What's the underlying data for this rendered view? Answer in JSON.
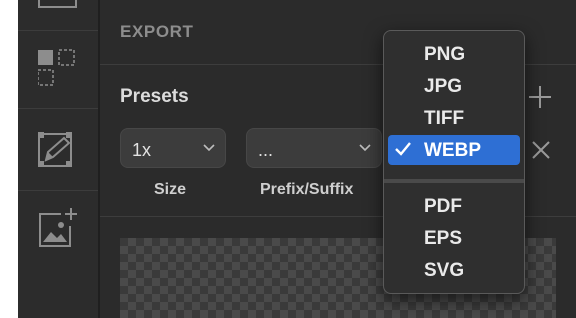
{
  "panel": {
    "section_title": "EXPORT",
    "presets_title": "Presets",
    "size_select": {
      "value": "1x",
      "label": "Size"
    },
    "prefix_select": {
      "value": "...",
      "label": "Prefix/Suffix"
    }
  },
  "format_menu": {
    "items": [
      "PNG",
      "JPG",
      "TIFF",
      "WEBP"
    ],
    "vector_items": [
      "PDF",
      "EPS",
      "SVG"
    ],
    "selected": "WEBP"
  },
  "colors": {
    "panel_bg": "#2b2b2b",
    "rail_bg": "#2c2c2c",
    "menu_bg": "#2f2f2f",
    "selection": "#2e6fd4"
  },
  "icons": [
    "artboard-icon",
    "select-slice-icon",
    "edit-slice-icon",
    "add-image-icon",
    "plus-icon",
    "close-icon",
    "chevron-down-icon",
    "checkmark-icon"
  ]
}
